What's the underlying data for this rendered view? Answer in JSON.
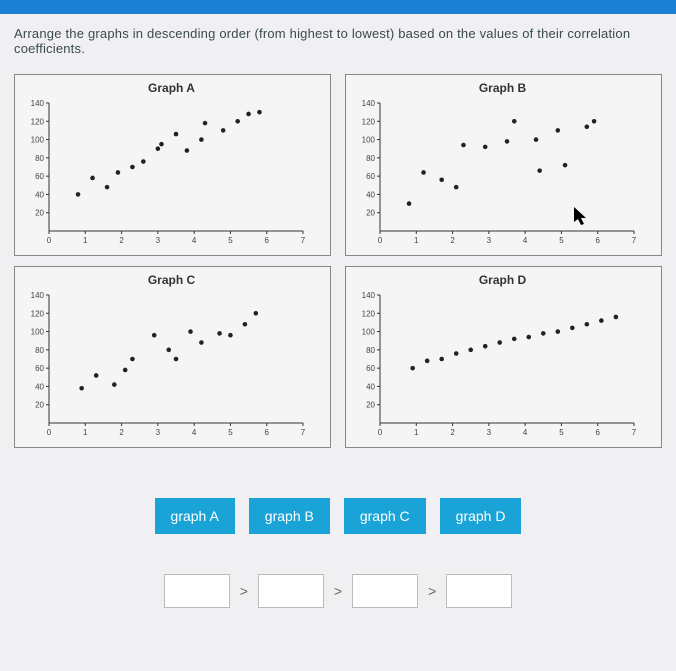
{
  "instruction": "Arrange the graphs in descending order (from highest to lowest) based on the values of their correlation coefficients.",
  "charts": {
    "A": {
      "title": "Graph A"
    },
    "B": {
      "title": "Graph B"
    },
    "C": {
      "title": "Graph C"
    },
    "D": {
      "title": "Graph D"
    }
  },
  "tiles": {
    "a": "graph A",
    "b": "graph B",
    "c": "graph C",
    "d": "graph D"
  },
  "operator": ">",
  "colors": {
    "accent": "#1aa3d6"
  },
  "chart_data": [
    {
      "type": "scatter",
      "title": "Graph A",
      "xlabel": "",
      "ylabel": "",
      "xlim": [
        0,
        7
      ],
      "ylim": [
        0,
        140
      ],
      "x_ticks": [
        0,
        1,
        2,
        3,
        4,
        5,
        6,
        7
      ],
      "y_ticks": [
        20,
        40,
        60,
        80,
        100,
        120,
        140
      ],
      "series": [
        {
          "name": "A",
          "x": [
            0.8,
            1.2,
            1.6,
            1.9,
            2.3,
            2.6,
            3.0,
            3.1,
            3.5,
            3.8,
            4.2,
            4.3,
            4.8,
            5.2,
            5.5,
            5.8
          ],
          "y": [
            40,
            58,
            48,
            64,
            70,
            76,
            90,
            95,
            106,
            88,
            100,
            118,
            110,
            120,
            128,
            130
          ]
        }
      ]
    },
    {
      "type": "scatter",
      "title": "Graph B",
      "xlabel": "",
      "ylabel": "",
      "xlim": [
        0,
        7
      ],
      "ylim": [
        0,
        140
      ],
      "x_ticks": [
        0,
        1,
        2,
        3,
        4,
        5,
        6,
        7
      ],
      "y_ticks": [
        20,
        40,
        60,
        80,
        100,
        120,
        140
      ],
      "series": [
        {
          "name": "B",
          "x": [
            0.8,
            1.2,
            1.7,
            2.1,
            2.3,
            2.9,
            3.5,
            3.7,
            4.3,
            4.4,
            4.9,
            5.1,
            5.7,
            5.9
          ],
          "y": [
            30,
            64,
            56,
            48,
            94,
            92,
            98,
            120,
            100,
            66,
            110,
            72,
            114,
            120
          ]
        }
      ]
    },
    {
      "type": "scatter",
      "title": "Graph C",
      "xlabel": "",
      "ylabel": "",
      "xlim": [
        0,
        7
      ],
      "ylim": [
        0,
        140
      ],
      "x_ticks": [
        0,
        1,
        2,
        3,
        4,
        5,
        6,
        7
      ],
      "y_ticks": [
        20,
        40,
        60,
        80,
        100,
        120,
        140
      ],
      "series": [
        {
          "name": "C",
          "x": [
            0.9,
            1.3,
            1.8,
            2.1,
            2.3,
            2.9,
            3.3,
            3.5,
            3.9,
            4.2,
            4.7,
            5.0,
            5.4,
            5.7
          ],
          "y": [
            38,
            52,
            42,
            58,
            70,
            96,
            80,
            70,
            100,
            88,
            98,
            96,
            108,
            120
          ]
        }
      ]
    },
    {
      "type": "scatter",
      "title": "Graph D",
      "xlabel": "",
      "ylabel": "",
      "xlim": [
        0,
        7
      ],
      "ylim": [
        0,
        140
      ],
      "x_ticks": [
        0,
        1,
        2,
        3,
        4,
        5,
        6,
        7
      ],
      "y_ticks": [
        20,
        40,
        60,
        80,
        100,
        120,
        140
      ],
      "series": [
        {
          "name": "D",
          "x": [
            0.9,
            1.3,
            1.7,
            2.1,
            2.5,
            2.9,
            3.3,
            3.7,
            4.1,
            4.5,
            4.9,
            5.3,
            5.7,
            6.1,
            6.5
          ],
          "y": [
            60,
            68,
            70,
            76,
            80,
            84,
            88,
            92,
            94,
            98,
            100,
            104,
            108,
            112,
            116
          ]
        }
      ]
    }
  ]
}
